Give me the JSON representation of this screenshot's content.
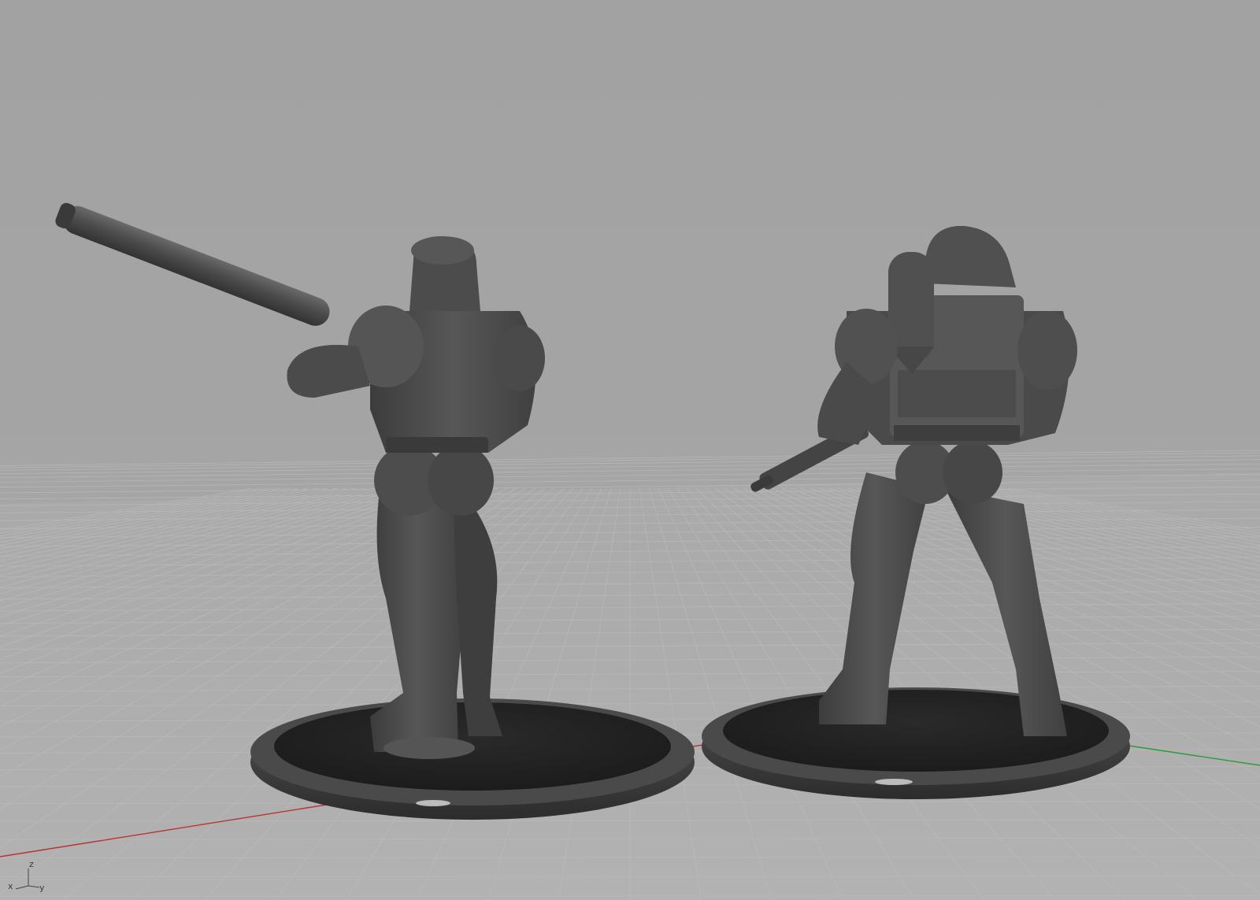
{
  "viewport": {
    "background_color": "#a3a3a3",
    "grid_color": "#bdbdbd",
    "axis_x_color": "#c03030",
    "axis_y_color": "#2f9a3a",
    "model_color": "#4a4a4a"
  },
  "axis_widget": {
    "x_label": "x",
    "y_label": "y",
    "z_label": "z"
  },
  "scene_objects": [
    {
      "name": "soldier-with-launcher",
      "type": "miniature-figure"
    },
    {
      "name": "soldier-with-backpack",
      "type": "miniature-figure"
    }
  ]
}
